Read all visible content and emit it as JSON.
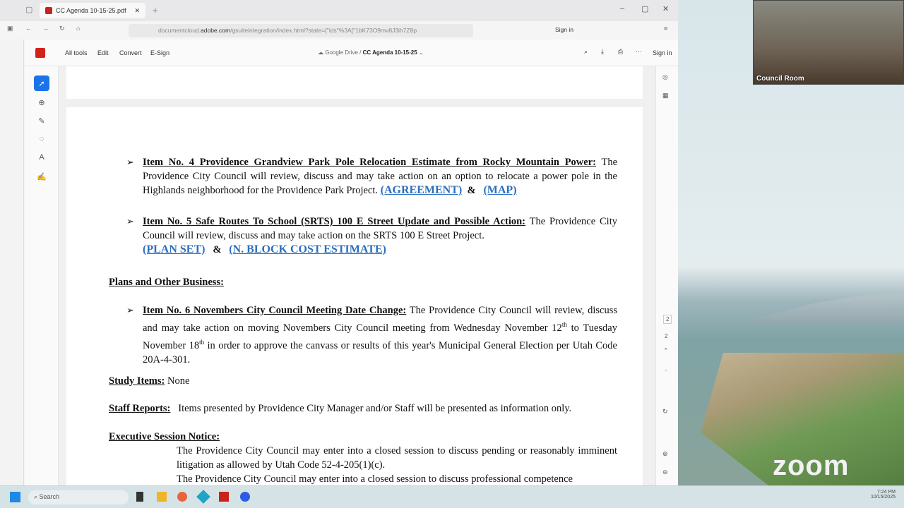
{
  "browser": {
    "tab_title": "CC Agenda 10-15-25.pdf",
    "url_prefix": "documentcloud.",
    "url_domain": "adobe.com",
    "url_rest": "/gsuiteintegration/index.html?state={\"ids\"%3A[\"1bK73O9mv8J3ih7Z8p",
    "sign_in": "Sign in"
  },
  "acrobat": {
    "menu": [
      "All tools",
      "Edit",
      "Convert",
      "E-Sign"
    ],
    "location": "Google Drive",
    "separator": "/",
    "doc_name": "CC Agenda 10-15-25",
    "sign_in": "Sign in"
  },
  "document": {
    "item4": {
      "label": "Item No.    4    Providence Grandview Park Pole Relocation Estimate from Rocky Mountain Power:",
      "text": " The Providence City Council will review, discuss and may take action on an option to relocate a power pole in the Highlands neighborhood for the Providence Park Project.",
      "link1": "(AGREEMENT)",
      "amp": "&",
      "link2": "(MAP)"
    },
    "item5": {
      "label": "Item No.     5    Safe Routes To School (SRTS) 100 E Street Update and Possible Action:",
      "text": " The Providence City Council will review, discuss and may take action on the SRTS 100 E Street Project.",
      "link1": "(PLAN SET)",
      "amp": "&",
      "link2": "(N. BLOCK COST ESTIMATE)"
    },
    "plans_heading": "Plans and Other Business:",
    "item6": {
      "label": "Item No.     6   Novembers City Council Meeting Date Change:",
      "text_a": " The Providence City Council will review, discuss and may take action on moving Novembers City Council meeting from Wednesday November 12",
      "sup1": "th",
      "text_b": " to Tuesday November 18",
      "sup2": "th",
      "text_c": " in order to approve the canvass or results of this year's Municipal General Election per Utah Code 20A-4-301."
    },
    "study_label": "Study Items:",
    "study_value": " None",
    "staff_label": "Staff Reports:",
    "staff_value": "Items presented by Providence City Manager and/or Staff will be presented as information only.",
    "exec_heading": "Executive Session Notice:",
    "exec_p1": "The Providence City Council may enter into a closed session to discuss pending or reasonably imminent litigation as allowed by Utah Code 52-4-205(1)(c).",
    "exec_p2": "The Providence City Council may enter into a closed session to discuss professional competence"
  },
  "page_indicator": {
    "current": "2",
    "total": "2"
  },
  "zoom": {
    "video_label": "Council Room",
    "logo": "zoom"
  },
  "taskbar": {
    "search": "Search",
    "time": "7:24 PM",
    "date": "10/15/2025"
  }
}
